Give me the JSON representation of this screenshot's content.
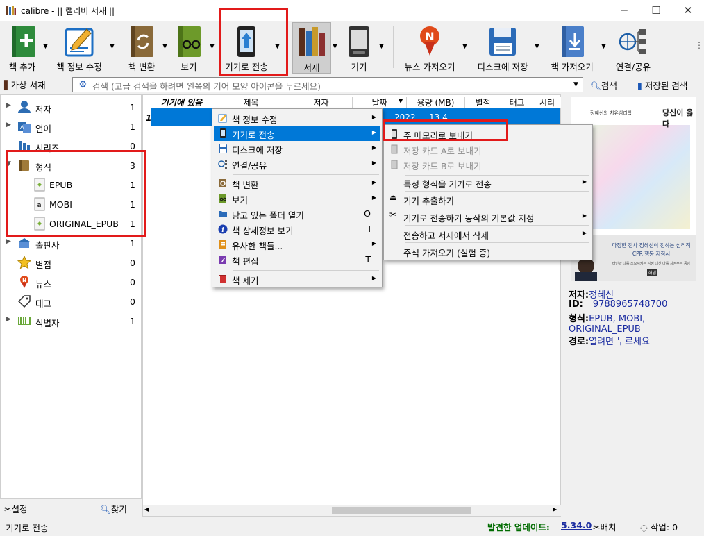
{
  "window": {
    "title": "calibre - || 캘리버 서재 ||",
    "minimize": "─",
    "maximize": "☐",
    "close": "✕"
  },
  "toolbar": {
    "add_book": "책 추가",
    "edit_metadata": "책 정보 수정",
    "convert": "책 변환",
    "view": "보기",
    "send_to_device": "기기로 전송",
    "library": "서재",
    "device": "기기",
    "fetch_news": "뉴스 가져오기",
    "save_to_disk": "디스크에 저장",
    "get_books": "책 가져오기",
    "connect_share": "연결/공유",
    "more": "⋮"
  },
  "search": {
    "virtual_library": "가상 서재",
    "placeholder": "검색 (고급 검색을 하려면 왼쪽의 기어 모양 아이콘을 누르세요)",
    "search_button": "검색",
    "saved_search": "저장된 검색"
  },
  "tag_browser": {
    "items": [
      {
        "label": "저자",
        "count": "1"
      },
      {
        "label": "언어",
        "count": "1"
      },
      {
        "label": "시리즈",
        "count": "0"
      },
      {
        "label": "형식",
        "count": "3"
      },
      {
        "label": "EPUB",
        "count": "1"
      },
      {
        "label": "MOBI",
        "count": "1"
      },
      {
        "label": "ORIGINAL_EPUB",
        "count": "1"
      },
      {
        "label": "출판사",
        "count": "1"
      },
      {
        "label": "별점",
        "count": "0"
      },
      {
        "label": "뉴스",
        "count": "0"
      },
      {
        "label": "태그",
        "count": "0"
      },
      {
        "label": "식별자",
        "count": "1"
      }
    ],
    "configure": "설정",
    "find": "찾기"
  },
  "book_list": {
    "columns": [
      "기기에 있음",
      "제목",
      "저자",
      "날짜",
      "용량 (MB)",
      "별점",
      "태그",
      "시리"
    ],
    "row_number": "1",
    "row_date": "2022",
    "row_size": "13.4"
  },
  "context_menu": {
    "items": [
      {
        "label": "책 정보 수정",
        "shortcut": ""
      },
      {
        "label": "기기로 전송",
        "shortcut": ""
      },
      {
        "label": "디스크에 저장",
        "shortcut": ""
      },
      {
        "label": "연결/공유",
        "shortcut": ""
      },
      {
        "label": "책 변환",
        "shortcut": ""
      },
      {
        "label": "보기",
        "shortcut": ""
      },
      {
        "label": "담고 있는 폴더 열기",
        "shortcut": "O"
      },
      {
        "label": "책 상세정보 보기",
        "shortcut": "I"
      },
      {
        "label": "유사한 책들...",
        "shortcut": ""
      },
      {
        "label": "책 편집",
        "shortcut": "T"
      },
      {
        "label": "책 제거",
        "shortcut": ""
      }
    ]
  },
  "submenu": {
    "items": [
      {
        "label": "주 메모리로 보내기"
      },
      {
        "label": "저장 카드 A로 보내기"
      },
      {
        "label": "저장 카드 B로 보내기"
      },
      {
        "label": "특정 형식을 기기로 전송"
      },
      {
        "label": "기기 추출하기"
      },
      {
        "label": "기기로 전송하기 동작의 기본값 지정"
      },
      {
        "label": "전송하고 서재에서 삭제"
      },
      {
        "label": "주석 가져오기 (실험 중)"
      }
    ]
  },
  "details": {
    "cover_author": "정혜신의 치유심리학",
    "cover_title": "당신이 옳다",
    "cover_subtitle": "다정한 전사 정혜신이 전하는 심리적 CPR 행동 지침서",
    "cover_line2": "타인과 나를 소모시키는 감정 대신 나를 지켜주는 공감",
    "cover_pub": "해냄",
    "author_label": "저자:",
    "author": "정혜신",
    "id_label": "ID:",
    "id": "9788965748700",
    "formats_label": "형식:",
    "formats": "EPUB, MOBI, ORIGINAL_EPUB",
    "path_label": "경로:",
    "path": "열려면 누르세요"
  },
  "status": {
    "left": "기기로 전송",
    "update_label": "발견한 업데이트:",
    "update_version": "5.34.0",
    "jobs_button": "배치",
    "jobs": "작업: 0"
  },
  "colors": {
    "accent": "#0078d7",
    "highlight_box": "#e21a1a",
    "update_green": "#006b00"
  }
}
